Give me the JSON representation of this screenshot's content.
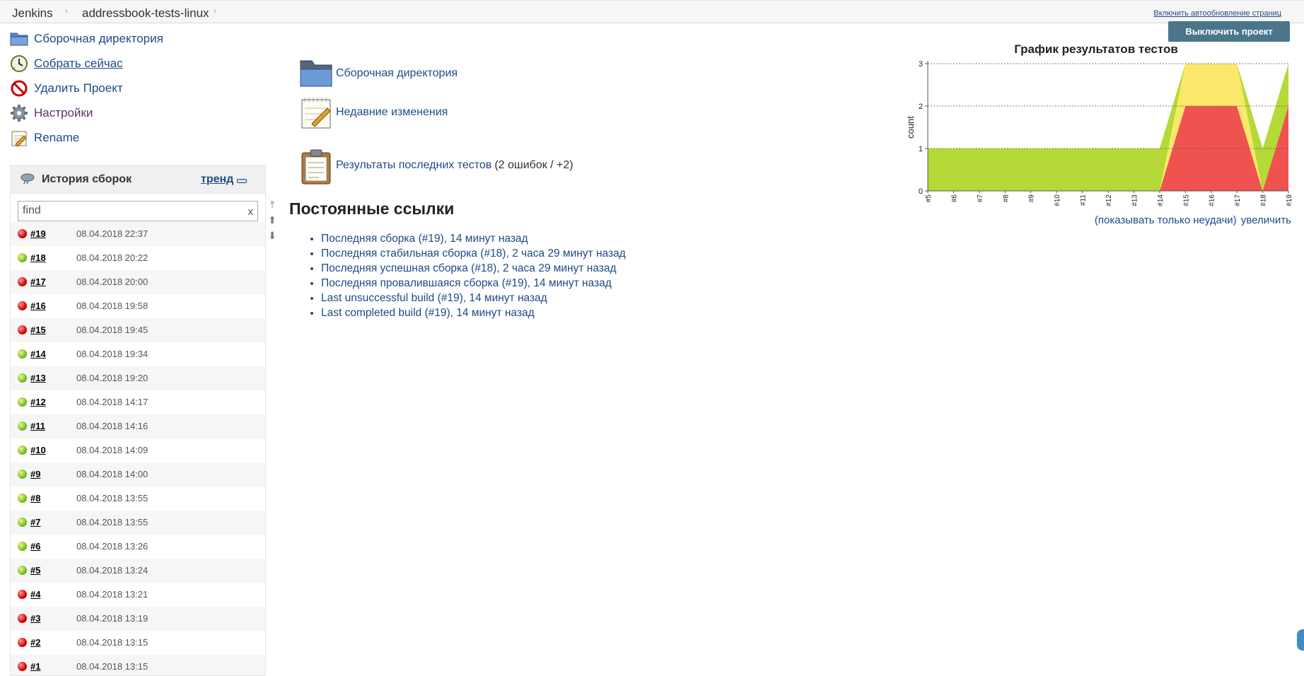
{
  "breadcrumb": {
    "items": [
      "Jenkins",
      "addressbook-tests-linux"
    ],
    "autorefresh": "Включить автообновление страниц"
  },
  "sidebar": {
    "tasks": [
      {
        "label": "Сборочная директория",
        "icon": "folder-icon"
      },
      {
        "label": "Собрать сейчас",
        "icon": "clock-icon"
      },
      {
        "label": "Удалить Проект",
        "icon": "no-entry-icon"
      },
      {
        "label": "Настройки",
        "icon": "gear-icon"
      },
      {
        "label": "Rename",
        "icon": "notepad-icon"
      }
    ]
  },
  "history": {
    "title": "История сборок",
    "trend": "тренд",
    "find_placeholder": "find",
    "find_clear": "x",
    "builds": [
      {
        "num": "#19",
        "date": "08.04.2018 22:37",
        "status": "red"
      },
      {
        "num": "#18",
        "date": "08.04.2018 20:22",
        "status": "green"
      },
      {
        "num": "#17",
        "date": "08.04.2018 20:00",
        "status": "red"
      },
      {
        "num": "#16",
        "date": "08.04.2018 19:58",
        "status": "red"
      },
      {
        "num": "#15",
        "date": "08.04.2018 19:45",
        "status": "red"
      },
      {
        "num": "#14",
        "date": "08.04.2018 19:34",
        "status": "green"
      },
      {
        "num": "#13",
        "date": "08.04.2018 19:20",
        "status": "green"
      },
      {
        "num": "#12",
        "date": "08.04.2018 14:17",
        "status": "green"
      },
      {
        "num": "#11",
        "date": "08.04.2018 14:16",
        "status": "green"
      },
      {
        "num": "#10",
        "date": "08.04.2018 14:09",
        "status": "green"
      },
      {
        "num": "#9",
        "date": "08.04.2018 14:00",
        "status": "green"
      },
      {
        "num": "#8",
        "date": "08.04.2018 13:55",
        "status": "green"
      },
      {
        "num": "#7",
        "date": "08.04.2018 13:55",
        "status": "green"
      },
      {
        "num": "#6",
        "date": "08.04.2018 13:26",
        "status": "green"
      },
      {
        "num": "#5",
        "date": "08.04.2018 13:24",
        "status": "green"
      },
      {
        "num": "#4",
        "date": "08.04.2018 13:21",
        "status": "red"
      },
      {
        "num": "#3",
        "date": "08.04.2018 13:19",
        "status": "red"
      },
      {
        "num": "#2",
        "date": "08.04.2018 13:15",
        "status": "red"
      },
      {
        "num": "#1",
        "date": "08.04.2018 13:15",
        "status": "red"
      }
    ]
  },
  "main": {
    "links": [
      {
        "label": "Сборочная директория",
        "icon": "folder-icon"
      },
      {
        "label": "Недавние изменения",
        "icon": "notepad-icon"
      },
      {
        "label": "Результаты последних тестов",
        "extra": "(2 ошибок / +2)",
        "icon": "clipboard-icon"
      }
    ],
    "permalinks_title": "Постоянные ссылки",
    "permalinks": [
      "Последняя сборка (#19), 14 минут назад",
      "Последняя стабильная сборка (#18), 2 часа 29 минут назад",
      "Последняя успешная сборка (#18), 2 часа 29 минут назад",
      "Последняя провалившаяся сборка (#19), 14 минут назад",
      "Last unsuccessful build (#19), 14 минут назад",
      "Last completed build (#19), 14 минут назад"
    ]
  },
  "actions": {
    "disable_project": "Выключить проект"
  },
  "chart_links": {
    "only_failures": "(показывать только неудачи)",
    "enlarge": "увеличить"
  },
  "chart_data": {
    "type": "area",
    "title": "График результатов тестов",
    "xlabel": "",
    "ylabel": "count",
    "ylim": [
      0,
      3
    ],
    "yticks": [
      "0",
      "1",
      "2",
      "3"
    ],
    "categories": [
      "#5",
      "#6",
      "#7",
      "#8",
      "#9",
      "#10",
      "#11",
      "#12",
      "#13",
      "#14",
      "#15",
      "#16",
      "#17",
      "#18",
      "#19"
    ],
    "series": [
      {
        "color": "#ef5350",
        "values": [
          0,
          0,
          0,
          0,
          0,
          0,
          0,
          0,
          0,
          0,
          2,
          2,
          2,
          0,
          2
        ]
      },
      {
        "color": "#fbe86a",
        "values": [
          0,
          0,
          0,
          0,
          0,
          0,
          0,
          0,
          0,
          0,
          1,
          1,
          1,
          0,
          0
        ]
      },
      {
        "color": "#b5d936",
        "values": [
          1,
          1,
          1,
          1,
          1,
          1,
          1,
          1,
          1,
          1,
          0,
          0,
          0,
          1,
          1
        ]
      }
    ],
    "grid": true
  },
  "colors": {
    "link": "#204a87",
    "button": "#4b758b"
  }
}
